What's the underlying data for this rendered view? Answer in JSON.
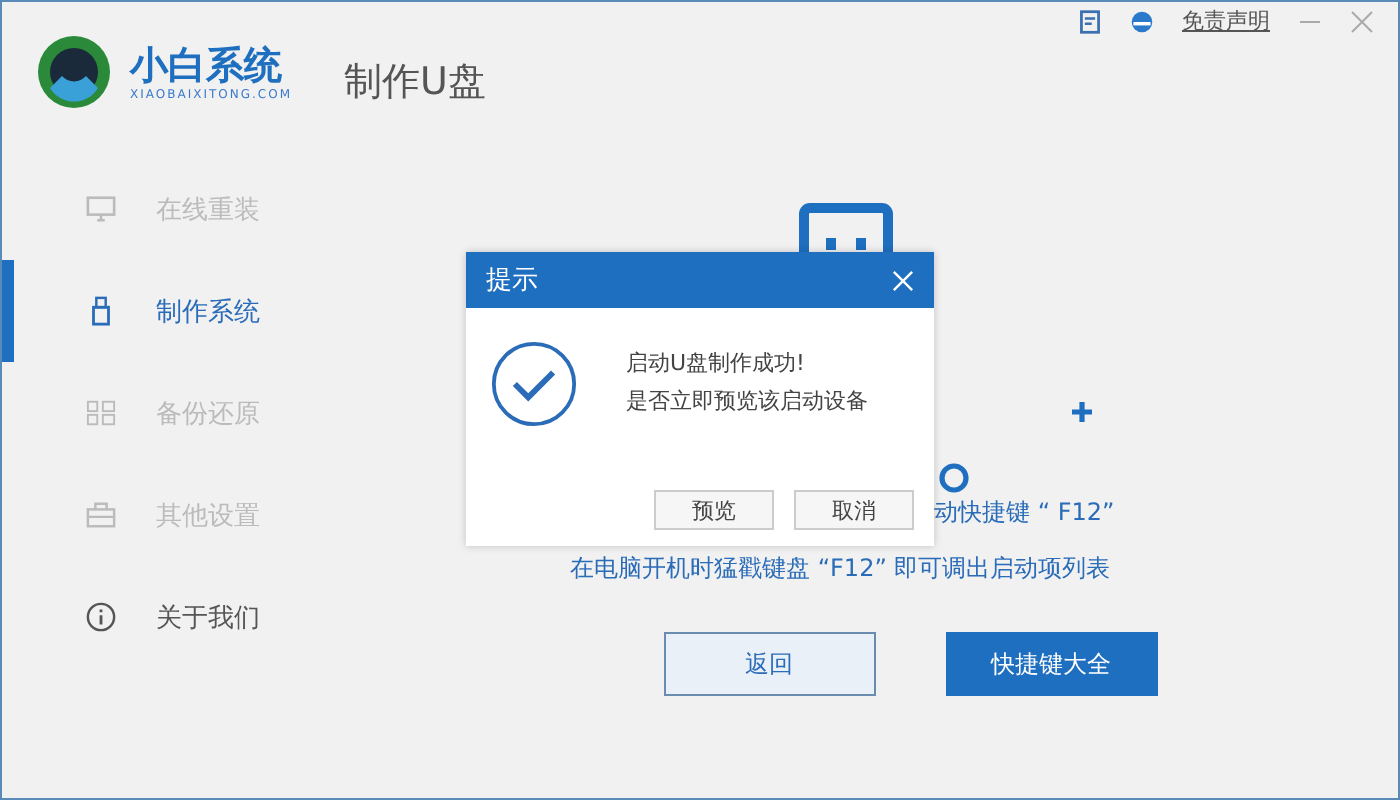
{
  "app": {
    "name": "小白系统",
    "domain": "XIAOBAIXITONG.COM",
    "page_title": "制作U盘"
  },
  "top_bar": {
    "disclaimer": "免责声明"
  },
  "sidebar": {
    "items": [
      {
        "label": "在线重装",
        "kind": "monitor",
        "selected": false,
        "dimmed": true
      },
      {
        "label": "制作系统",
        "kind": "usb",
        "selected": true,
        "dimmed": false
      },
      {
        "label": "备份还原",
        "kind": "grid",
        "selected": false,
        "dimmed": true
      },
      {
        "label": "其他设置",
        "kind": "box",
        "selected": false,
        "dimmed": true
      },
      {
        "label": "关于我们",
        "kind": "info",
        "selected": false,
        "dimmed": false
      }
    ]
  },
  "main": {
    "hint_line_1": "动快捷键 “ F12”",
    "hint_line_2": "在电脑开机时猛戳键盘 “F12” 即可调出启动项列表",
    "buttons": [
      {
        "label": "返回",
        "primary": false
      },
      {
        "label": "快捷键大全",
        "primary": true
      }
    ]
  },
  "dialog": {
    "title": "提示",
    "message_line_1": "启动U盘制作成功!",
    "message_line_2": "是否立即预览该启动设备",
    "buttons": [
      "预览",
      "取消"
    ]
  }
}
